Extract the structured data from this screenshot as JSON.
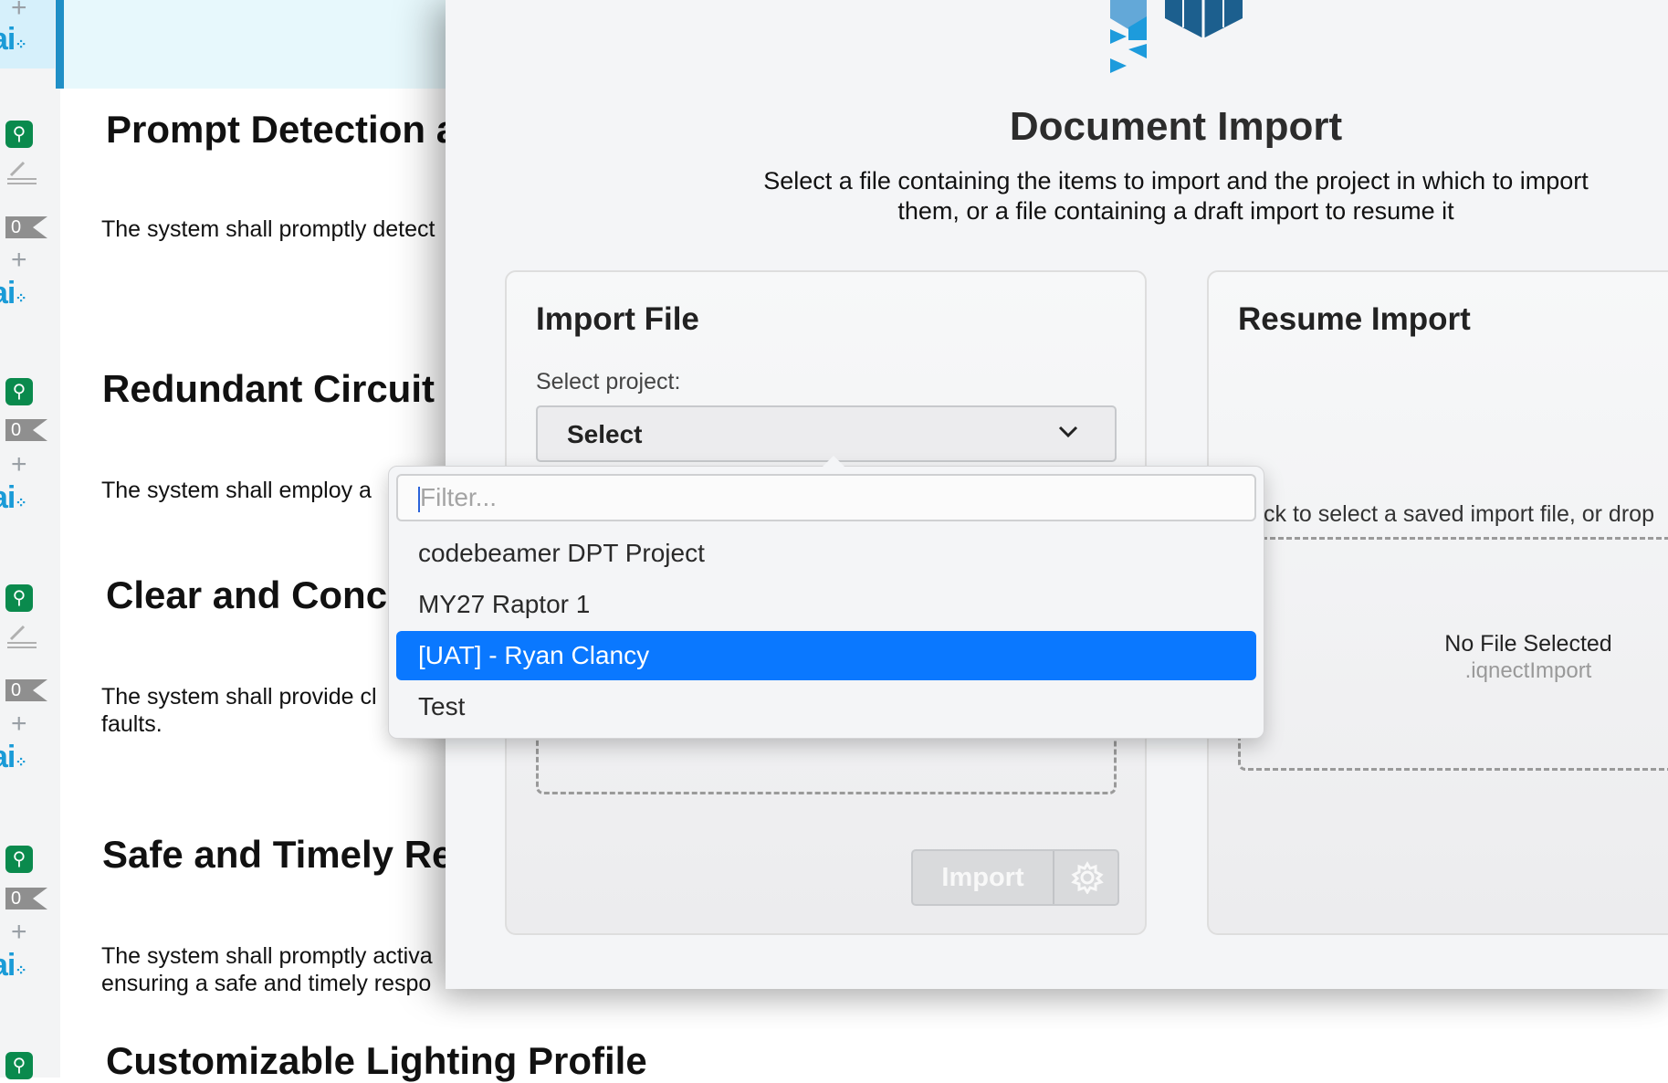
{
  "document": {
    "sections": [
      {
        "title": "Prompt Detection a",
        "text": [
          "The system shall promptly detect"
        ]
      },
      {
        "title": "Redundant Circuit",
        "text": [
          "The system shall employ a"
        ]
      },
      {
        "title": "Clear and Conc",
        "text": [
          "The system shall provide cl",
          "faults."
        ]
      },
      {
        "title": "Safe and Timely Re",
        "text": [
          "The system shall promptly activa",
          "ensuring a safe and timely respo"
        ]
      },
      {
        "title": "Customizable Lighting Profile",
        "text": []
      }
    ],
    "gutter": {
      "counts": [
        "0",
        "0",
        "0",
        "0"
      ],
      "ai_label": "ai"
    }
  },
  "modal": {
    "title": "Document Import",
    "subtitle_line1": "Select a file containing the items to import and the project in which to import",
    "subtitle_line2": "them, or a file containing a draft import to resume it",
    "import_panel": {
      "title": "Import File",
      "project_label": "Select project:",
      "select_value": "Select",
      "import_button": "Import"
    },
    "resume_panel": {
      "title": "Resume Import",
      "hint": "ck to select a saved import file, or drop",
      "no_file": "No File Selected",
      "extension": ".iqnectImport"
    }
  },
  "dropdown": {
    "filter_placeholder": "Filter...",
    "options": [
      "codebeamer DPT Project",
      "MY27 Raptor 1",
      "[UAT] - Ryan Clancy",
      "Test"
    ],
    "selected_index": 2
  },
  "colors": {
    "selected": "#0a78ff",
    "brand": "#1a9bd7",
    "bulb": "#0a8a4d"
  }
}
